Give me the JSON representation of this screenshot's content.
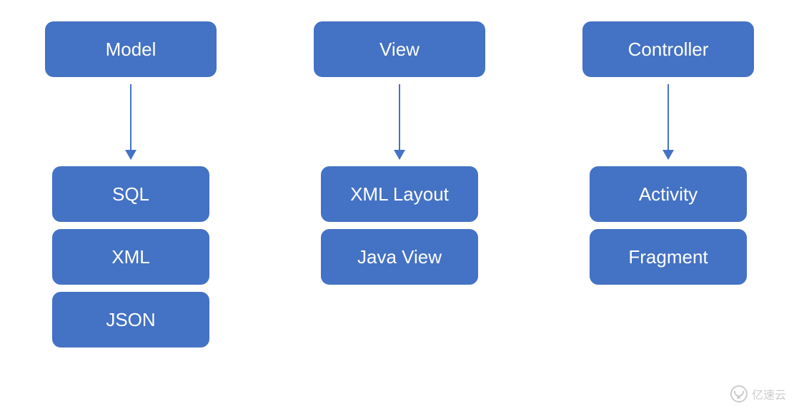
{
  "columns": [
    {
      "header": "Model",
      "children": [
        "SQL",
        "XML",
        "JSON"
      ]
    },
    {
      "header": "View",
      "children": [
        "XML Layout",
        "Java View"
      ]
    },
    {
      "header": "Controller",
      "children": [
        "Activity",
        "Fragment"
      ]
    }
  ],
  "watermark": "亿速云"
}
